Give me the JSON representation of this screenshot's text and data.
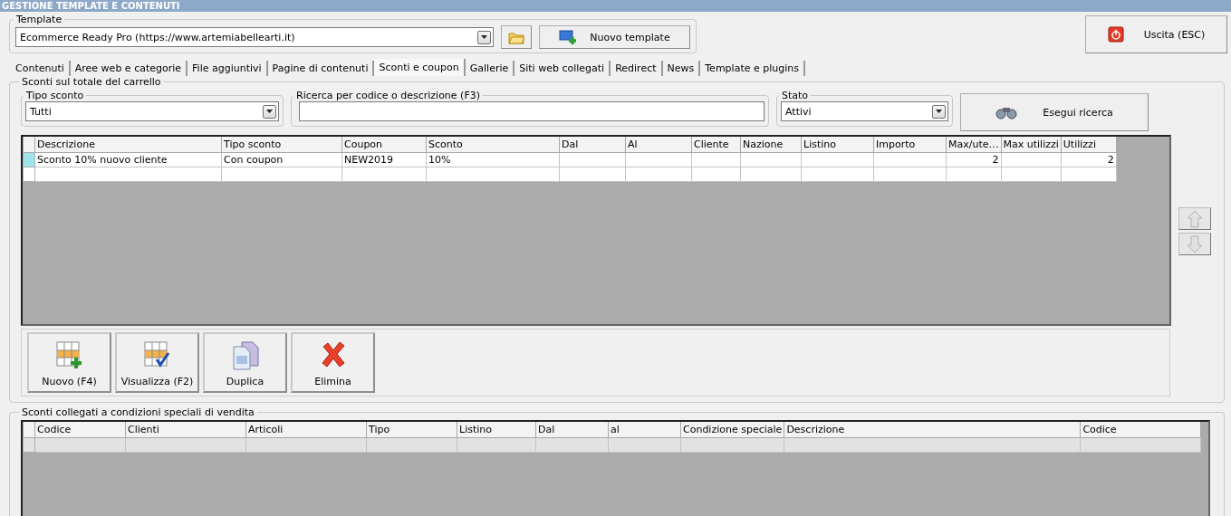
{
  "window": {
    "title": "GESTIONE TEMPLATE E CONTENUTI"
  },
  "template": {
    "label": "Template",
    "value": "Ecommerce Ready Pro (https://www.artemiabellearti.it)",
    "new_button": "Nuovo template"
  },
  "exit_button": "Uscita (ESC)",
  "tabs": [
    {
      "label": "Contenuti",
      "selected": false
    },
    {
      "label": "Aree web e categorie",
      "selected": false
    },
    {
      "label": "File aggiuntivi",
      "selected": false
    },
    {
      "label": "Pagine di contenuti",
      "selected": false
    },
    {
      "label": "Sconti e coupon",
      "selected": true
    },
    {
      "label": "Gallerie",
      "selected": false
    },
    {
      "label": "Siti web collegati",
      "selected": false
    },
    {
      "label": "Redirect",
      "selected": false
    },
    {
      "label": "News",
      "selected": false
    },
    {
      "label": "Template e plugins",
      "selected": false
    }
  ],
  "cart_discounts": {
    "title": "Sconti sul totale del carrello",
    "filters": {
      "type": {
        "label": "Tipo sconto",
        "value": "Tutti"
      },
      "search": {
        "label": "Ricerca per codice o descrizione (F3)"
      },
      "status": {
        "label": "Stato",
        "value": "Attivi"
      },
      "search_button": "Esegui ricerca"
    },
    "table": {
      "columns": [
        {
          "label": "Descrizione",
          "kind": "text"
        },
        {
          "label": "Tipo sconto",
          "kind": "text"
        },
        {
          "label": "Coupon",
          "kind": "text"
        },
        {
          "label": "Sconto",
          "kind": "text"
        },
        {
          "label": "Dal",
          "kind": "text"
        },
        {
          "label": "Al",
          "kind": "text"
        },
        {
          "label": "Cliente",
          "kind": "text"
        },
        {
          "label": "Nazione",
          "kind": "text"
        },
        {
          "label": "Listino",
          "kind": "text"
        },
        {
          "label": "Importo",
          "kind": "text"
        },
        {
          "label": "Max/ute…",
          "kind": "number"
        },
        {
          "label": "Max utilizzi",
          "kind": "number"
        },
        {
          "label": "Utilizzi",
          "kind": "number"
        }
      ],
      "rows": [
        {
          "selected": true,
          "cells": [
            "Sconto 10% nuovo cliente",
            "Con coupon",
            "NEW2019",
            "10%",
            "",
            "",
            "",
            "",
            "",
            "",
            "2",
            "",
            "2"
          ]
        }
      ]
    },
    "actions": [
      {
        "label": "Nuovo (F4)",
        "kind": "new"
      },
      {
        "label": "Visualizza (F2)",
        "kind": "view"
      },
      {
        "label": "Duplica",
        "kind": "duplicate"
      },
      {
        "label": "Elimina",
        "kind": "delete"
      }
    ]
  },
  "special_discounts": {
    "title": "Sconti collegati a condizioni speciali di vendita",
    "table": {
      "columns": [
        {
          "label": "Codice"
        },
        {
          "label": "Clienti"
        },
        {
          "label": "Articoli"
        },
        {
          "label": "Tipo"
        },
        {
          "label": "Listino"
        },
        {
          "label": "Dal"
        },
        {
          "label": "al"
        },
        {
          "label": "Condizione speciale"
        },
        {
          "label": "Descrizione"
        },
        {
          "label": "Codice"
        }
      ]
    }
  }
}
